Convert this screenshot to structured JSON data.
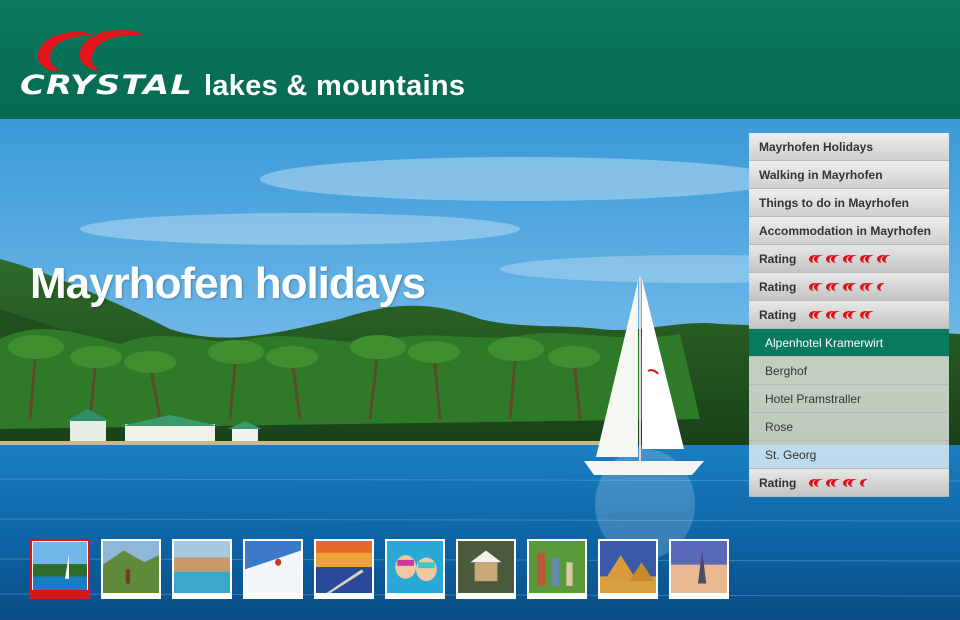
{
  "header": {
    "logo_text": "CRYSTAL",
    "tagline": "lakes & mountains"
  },
  "hero": {
    "title": "Mayrhofen holidays"
  },
  "menu": {
    "items": [
      {
        "label": "Mayrhofen Holidays"
      },
      {
        "label": "Walking in Mayrhofen"
      },
      {
        "label": "Things to do in Mayrhofen"
      },
      {
        "label": "Accommodation in Mayrhofen"
      }
    ],
    "ratings": [
      {
        "label": "Rating",
        "value": 5
      },
      {
        "label": "Rating",
        "value": 4.5
      },
      {
        "label": "Rating",
        "value": 4
      }
    ],
    "hotels": [
      {
        "label": "Alpenhotel Kramerwirt",
        "active": true
      },
      {
        "label": "Berghof"
      },
      {
        "label": "Hotel Pramstraller"
      },
      {
        "label": "Rose"
      },
      {
        "label": "St. Georg"
      }
    ],
    "last_rating": {
      "label": "Rating",
      "value": 3.5
    }
  },
  "thumbnails": [
    {
      "name": "lake-sailboat",
      "selected": true
    },
    {
      "name": "hiking"
    },
    {
      "name": "resort-pool"
    },
    {
      "name": "skier"
    },
    {
      "name": "sunset-pier"
    },
    {
      "name": "kids-swimming"
    },
    {
      "name": "gazebo"
    },
    {
      "name": "family-walk"
    },
    {
      "name": "pyramids"
    },
    {
      "name": "burj-sunset"
    }
  ],
  "colors": {
    "brand_green": "#087a5d",
    "brand_red": "#d9141a"
  }
}
